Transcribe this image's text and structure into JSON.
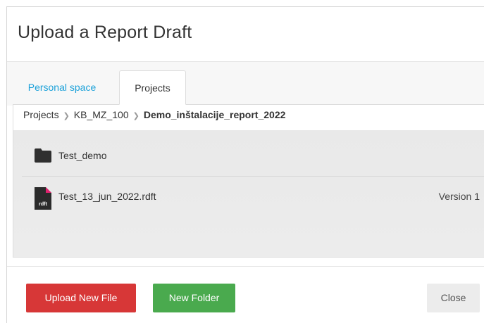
{
  "dialog": {
    "title": "Upload a Report Draft"
  },
  "tabs": [
    {
      "label": "Personal space",
      "active": false
    },
    {
      "label": "Projects",
      "active": true
    }
  ],
  "breadcrumb": {
    "items": [
      "Projects",
      "KB_MZ_100"
    ],
    "current": "Demo_inštalacije_report_2022"
  },
  "files": [
    {
      "type": "folder",
      "icon": "folder-icon",
      "name": "Test_demo",
      "version": ""
    },
    {
      "type": "file",
      "icon": "rdft-file-icon",
      "icon_text": "rdft",
      "name": "Test_13_jun_2022.rdft",
      "version": "Version 1"
    }
  ],
  "buttons": {
    "upload": "Upload New File",
    "new_folder": "New Folder",
    "close": "Close"
  },
  "colors": {
    "accent_blue": "#1ba1d9",
    "upload_red": "#d73737",
    "new_folder_green": "#4aaa4e",
    "file_icon_corner": "#e2216f"
  }
}
